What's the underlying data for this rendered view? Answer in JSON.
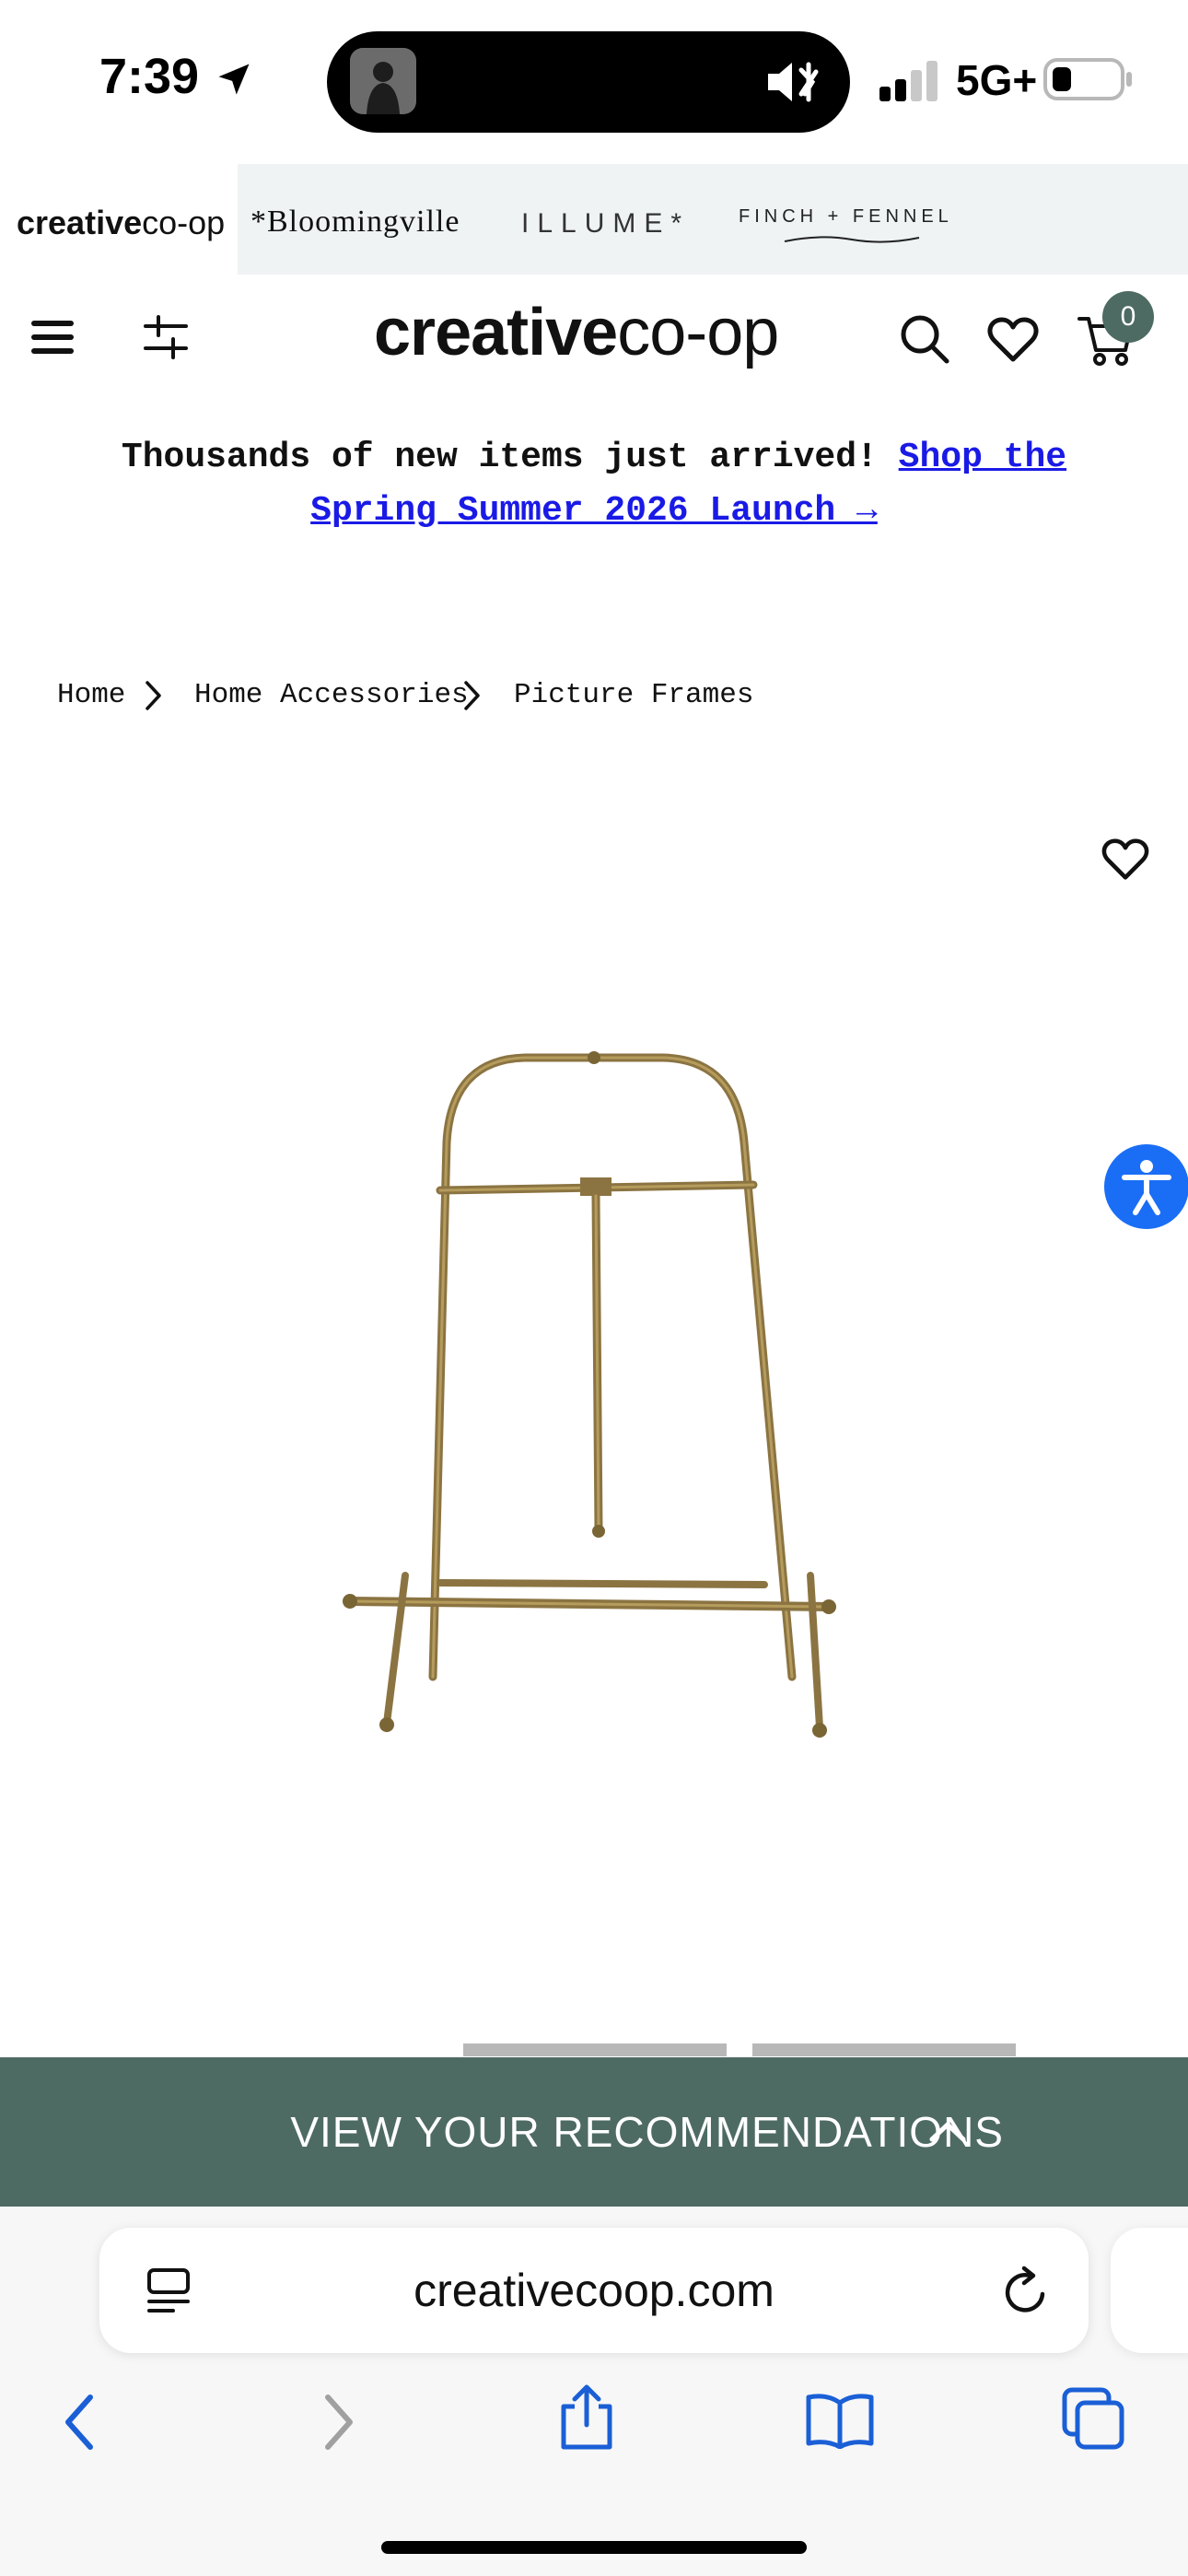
{
  "status_bar": {
    "time": "7:39",
    "network": "5G+"
  },
  "brand_strip": {
    "brands": [
      "creativeco-op",
      "*Bloomingville",
      "ILLUME*",
      "FINCH + FENNEL"
    ],
    "creative_bold": "creative",
    "creative_light": "co-op",
    "bloomingville": "*Bloomingville",
    "illume": "ILLUME*",
    "finch": "FINCH + FENNEL"
  },
  "header": {
    "logo_bold": "creative",
    "logo_light": "co-op",
    "cart_count": "0"
  },
  "announcement": {
    "text": "Thousands of new items just arrived!",
    "link": "Shop the Spring Summer 2026 Launch →"
  },
  "breadcrumbs": [
    "Home",
    "Home Accessories",
    "Picture Frames"
  ],
  "recommendations": {
    "label": "VIEW YOUR RECOMMENDATIONS"
  },
  "browser": {
    "url": "creativecoop.com"
  },
  "colors": {
    "brand_green": "#4e6b63",
    "link_blue": "#1a1ae6",
    "accessibility_blue": "#1a6ef5"
  }
}
